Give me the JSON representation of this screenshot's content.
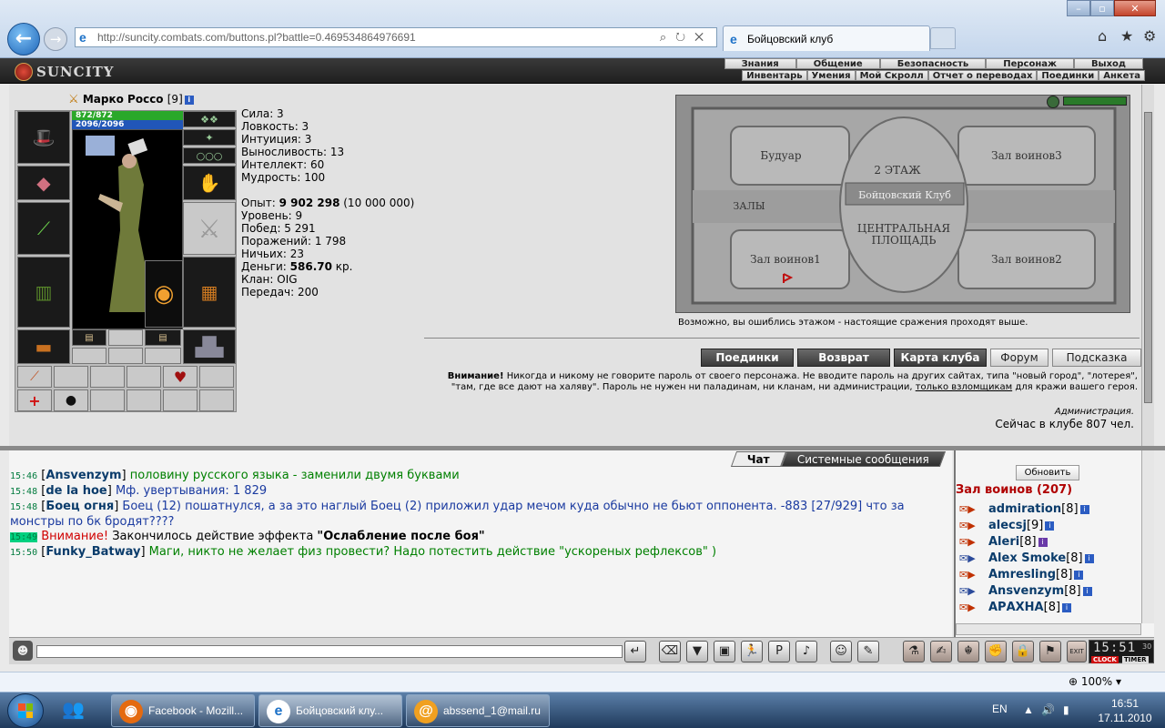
{
  "browser": {
    "url": "http://suncity.combats.com/buttons.pl?battle=0.469534864976691",
    "tab_title": "Бойцовский клуб",
    "zoom": "100%"
  },
  "game_menu": {
    "logo": "SUNCITY",
    "top": [
      "Знания",
      "Общение",
      "Безопасность",
      "Персонаж",
      "Выход"
    ],
    "sub": [
      "Инвентарь",
      "Умения",
      "Мой Скролл",
      "Отчет о переводах",
      "Поединки",
      "Анкета"
    ]
  },
  "character": {
    "name": "Марко Россо",
    "level": "[9]",
    "hp": "872/872",
    "mana": "2096/2096"
  },
  "stats": {
    "sila": "Сила: 3",
    "lovkost": "Ловкость: 3",
    "intuition": "Интуиция: 3",
    "vynoslivost": "Выносливость: 13",
    "intellekt": "Интеллект: 60",
    "mudrost": "Мудрость: 100",
    "opyt_label": "Опыт: ",
    "opyt_value": "9 902 298",
    "opyt_next": " (10 000 000)",
    "uroven": "Уровень: 9",
    "pobed": "Побед: 5 291",
    "porazheniy": "Поражений: 1 798",
    "nichih": "Ничьих: 23",
    "dengi_label": "Деньги: ",
    "dengi_value": "586.70",
    "dengi_unit": " кр.",
    "klan": "Клан: OIG",
    "peredach": "Передач: 200"
  },
  "map": {
    "labels": {
      "boudoir": "Будуар",
      "warriors3": "Зал воинов3",
      "floor": "2 ЭТАЖ",
      "halls": "ЗАЛЫ",
      "club": "Бойцовский Клуб",
      "square1": "ЦЕНТРАЛЬНАЯ",
      "square2": "ПЛОЩАДЬ",
      "warriors1": "Зал воинов1",
      "warriors2": "Зал воинов2"
    },
    "note": "Возможно, вы ошиблись этажом - настоящие сражения проходят выше."
  },
  "actions": {
    "duels": "Поединки",
    "back": "Возврат",
    "club_map": "Карта клуба",
    "forum": "Форум",
    "hint": "Подсказка"
  },
  "warning": {
    "title": "Внимание!",
    "text1": " Никогда и никому не говорите пароль от своего персонажа. Не вводите пароль на других сайтах, типа \"новый город\", \"лотерея\", \"там, где все дают на халяву\". Пароль не нужен ни паладинам, ни кланам, ни администрации, ",
    "link": "только взломщикам",
    "text2": " для кражи вашего героя.",
    "admin": "Администрация.",
    "online": "Сейчас в клубе 807 чел."
  },
  "chat": {
    "tabs": [
      "Чат",
      "Системные сообщения"
    ],
    "messages": [
      {
        "time": "15:46",
        "nick": "Ansvenzym",
        "text": " половину русского языка - заменили двумя буквами",
        "color": "green"
      },
      {
        "time": "15:48",
        "nick": "de la hoe",
        "text": " Мф. увертывания: 1 829",
        "color": "blue"
      },
      {
        "time": "15:48",
        "nick": "Боец огня",
        "text": " Боец (12) пошатнулся, а за это наглый Боец (2) приложил удар мечом куда обычно не бьют оппонента. -883 [27/929] что за монстры по бк бродят????",
        "color": "blue"
      },
      {
        "time": "15:49",
        "label": "Внимание!",
        "text": " Закончилось действие эффекта ",
        "effect": "\"Ослабление после боя\""
      },
      {
        "time": "15:50",
        "nick": "Funky_Batway",
        "text": " Маги, никто не желает физ провести? Надо потестить действие \"ускореных рефлексов\" )",
        "color": "green"
      }
    ]
  },
  "online_list": {
    "refresh": "Обновить",
    "room": "Зал воинов (207)",
    "users": [
      {
        "name": "admiration",
        "level": "[8]"
      },
      {
        "name": "alecsj",
        "level": "[9]"
      },
      {
        "name": "Aleri",
        "level": "[8]"
      },
      {
        "name": "Alex Smoke",
        "level": "[8]"
      },
      {
        "name": "Amresling",
        "level": "[8]"
      },
      {
        "name": "Ansvenzym",
        "level": "[8]"
      },
      {
        "name": "АРАХНА",
        "level": "[8]"
      }
    ]
  },
  "clock": {
    "time": "15:51",
    "sec": "30",
    "clock_label": "CLOCK",
    "timer_label": "TIMER"
  },
  "taskbar": {
    "items": [
      "Facebook - Mozill...",
      "Бойцовский клу...",
      "abssend_1@mail.ru"
    ],
    "lang": "EN",
    "time": "16:51",
    "date": "17.11.2010"
  }
}
